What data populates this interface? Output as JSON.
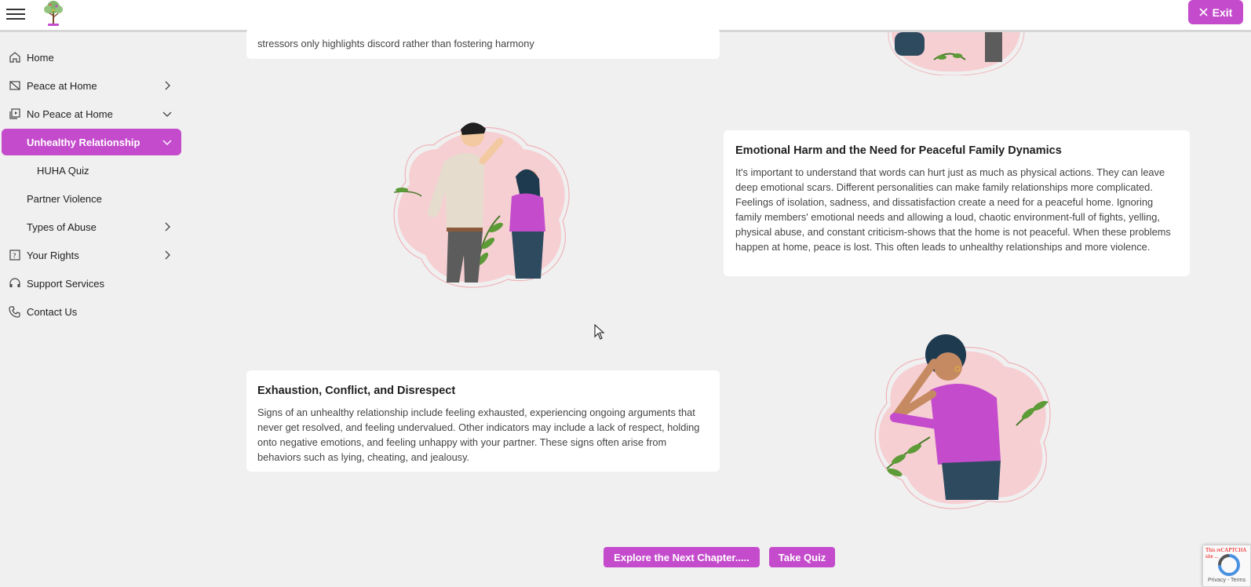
{
  "header": {
    "exit_label": "Exit"
  },
  "sidebar": {
    "items": [
      {
        "label": "Home"
      },
      {
        "label": "Peace at Home"
      },
      {
        "label": "No Peace at Home"
      },
      {
        "label": "Unhealthy Relationship"
      },
      {
        "label": "HUHA Quiz"
      },
      {
        "label": "Partner Violence"
      },
      {
        "label": "Types of Abuse"
      },
      {
        "label": "Your Rights"
      },
      {
        "label": "Support Services"
      },
      {
        "label": "Contact Us"
      }
    ]
  },
  "content": {
    "top_card_text": "stressors only highlights discord rather than fostering harmony",
    "card1": {
      "title": "Emotional Harm and the Need for Peaceful Family Dynamics",
      "body": "It's important to understand that words can hurt just as much as physical actions. They can leave deep emotional scars. Different personalities can make family relationships more complicated. Feelings of isolation, sadness, and dissatisfaction create a need for a peaceful home. Ignoring family members' emotional needs and allowing a loud, chaotic environment-full of fights, yelling, physical abuse, and constant criticism-shows that the home is not peaceful. When these problems happen at home, peace is lost. This often leads to unhealthy relationships and more violence."
    },
    "card2": {
      "title": "Exhaustion, Conflict, and Disrespect",
      "body": "Signs of an unhealthy relationship include feeling exhausted, experiencing ongoing arguments that never get resolved, and feeling undervalued. Other indicators may include a lack of respect, holding onto negative emotions, and feeling unhappy with your partner. These signs often arise from behaviors such as lying, cheating, and jealousy."
    }
  },
  "buttons": {
    "next_chapter": "Explore the Next Chapter.....",
    "take_quiz": "Take Quiz"
  },
  "recaptcha": {
    "notice": "This reCAPTCHA site ...",
    "terms": "Privacy - Terms"
  },
  "colors": {
    "accent": "#c44ccc",
    "background": "#f0f0f0"
  }
}
